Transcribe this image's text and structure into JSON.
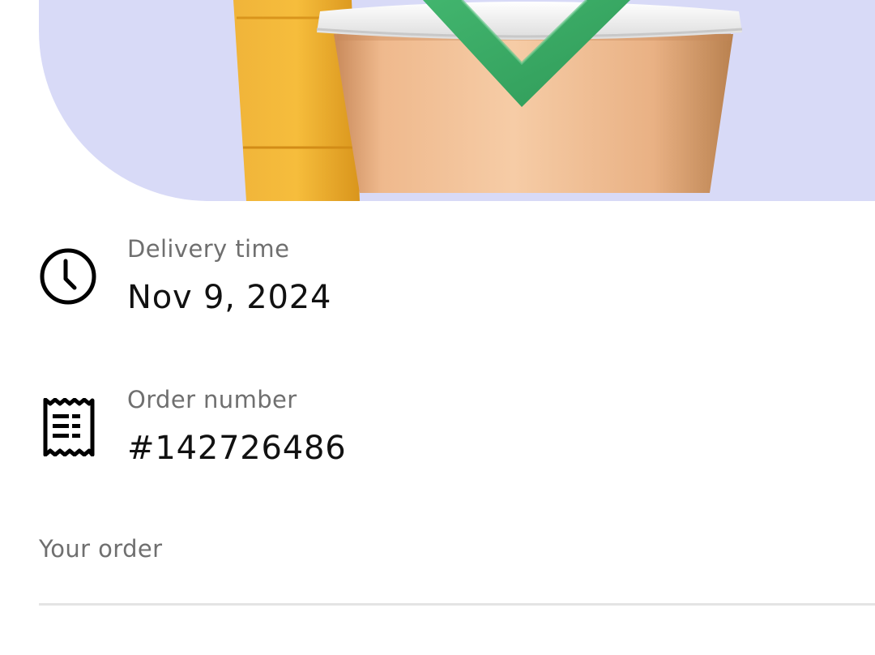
{
  "hero": {
    "image": "drinks-cups-with-green-checkmark",
    "background_color": "#d8daf7",
    "check_color": "#3aa864"
  },
  "delivery": {
    "icon": "clock-icon",
    "label": "Delivery time",
    "value": "Nov 9, 2024"
  },
  "order": {
    "icon": "receipt-icon",
    "label": "Order number",
    "value": "#142726486"
  },
  "your_order": {
    "title": "Your order"
  }
}
